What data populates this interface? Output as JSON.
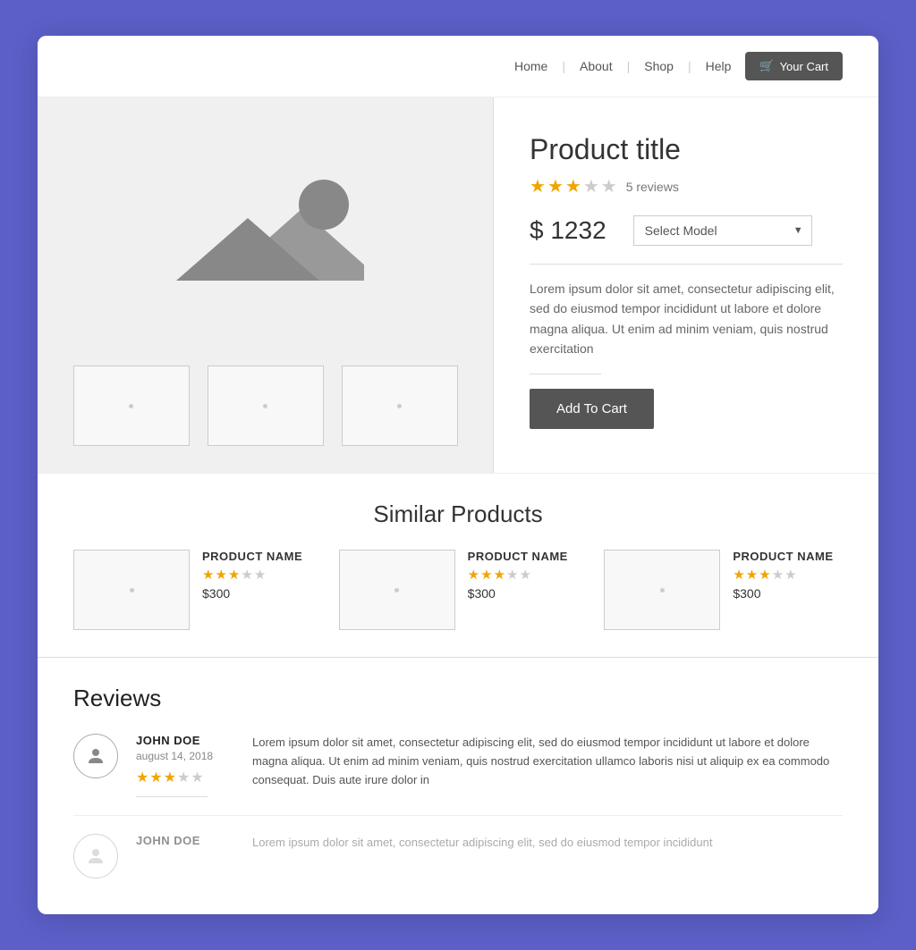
{
  "nav": {
    "links": [
      "Home",
      "About",
      "Shop",
      "Help"
    ],
    "cart_label": "Your Cart",
    "cart_icon": "🛒"
  },
  "product": {
    "title": "Product title",
    "rating": 3,
    "max_rating": 5,
    "review_count": "5 reviews",
    "price": "$ 1232",
    "model_select_placeholder": "Select Model",
    "description": "Lorem ipsum dolor sit amet, consectetur adipiscing elit, sed do eiusmod tempor incididunt ut labore et dolore magna aliqua. Ut enim ad minim veniam, quis nostrud exercitation",
    "add_to_cart_label": "Add To Cart"
  },
  "similar": {
    "title": "Similar Products",
    "items": [
      {
        "name": "PRODUCT NAME",
        "rating": 3,
        "max_rating": 5,
        "price": "$300"
      },
      {
        "name": "PRODUCT NAME",
        "rating": 3,
        "max_rating": 5,
        "price": "$300"
      },
      {
        "name": "PRODUCT NAME",
        "rating": 3,
        "max_rating": 5,
        "price": "$300"
      }
    ]
  },
  "reviews": {
    "title": "Reviews",
    "items": [
      {
        "name": "JOHN DOE",
        "date": "august 14, 2018",
        "rating": 3,
        "max_rating": 5,
        "text": "Lorem ipsum dolor sit amet, consectetur adipiscing elit, sed do eiusmod tempor incididunt ut labore et dolore magna aliqua. Ut enim ad minim veniam, quis nostrud exercitation ullamco laboris nisi ut aliquip ex ea commodo consequat. Duis aute irure dolor in"
      },
      {
        "name": "JOHN DOE",
        "date": "",
        "rating": 0,
        "max_rating": 5,
        "text": "Lorem ipsum dolor sit amet, consectetur adipiscing elit, sed do eiusmod tempor incididunt"
      }
    ]
  }
}
